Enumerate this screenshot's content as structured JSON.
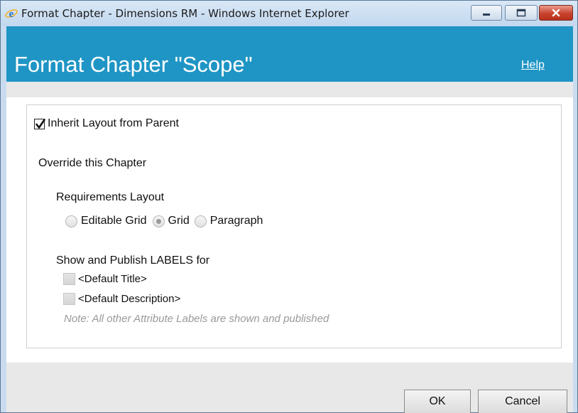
{
  "window": {
    "title": "Format Chapter - Dimensions RM - Windows Internet Explorer"
  },
  "header": {
    "title": "Format Chapter \"Scope\"",
    "help_label": "Help",
    "color": "#1f95c5"
  },
  "form": {
    "inherit": {
      "label": "Inherit Layout from Parent",
      "checked": true
    },
    "override_label": "Override this Chapter",
    "requirements_layout": {
      "label": "Requirements Layout",
      "options": [
        {
          "label": "Editable Grid",
          "selected": false
        },
        {
          "label": "Grid",
          "selected": true
        },
        {
          "label": "Paragraph",
          "selected": false
        }
      ]
    },
    "labels_section": {
      "label": "Show and Publish LABELS for",
      "items": [
        {
          "label": "<Default Title>",
          "checked": false
        },
        {
          "label": "<Default Description>",
          "checked": false
        }
      ],
      "note": "Note: All other Attribute Labels are shown and published"
    }
  },
  "buttons": {
    "ok_label": "OK",
    "cancel_label": "Cancel"
  }
}
